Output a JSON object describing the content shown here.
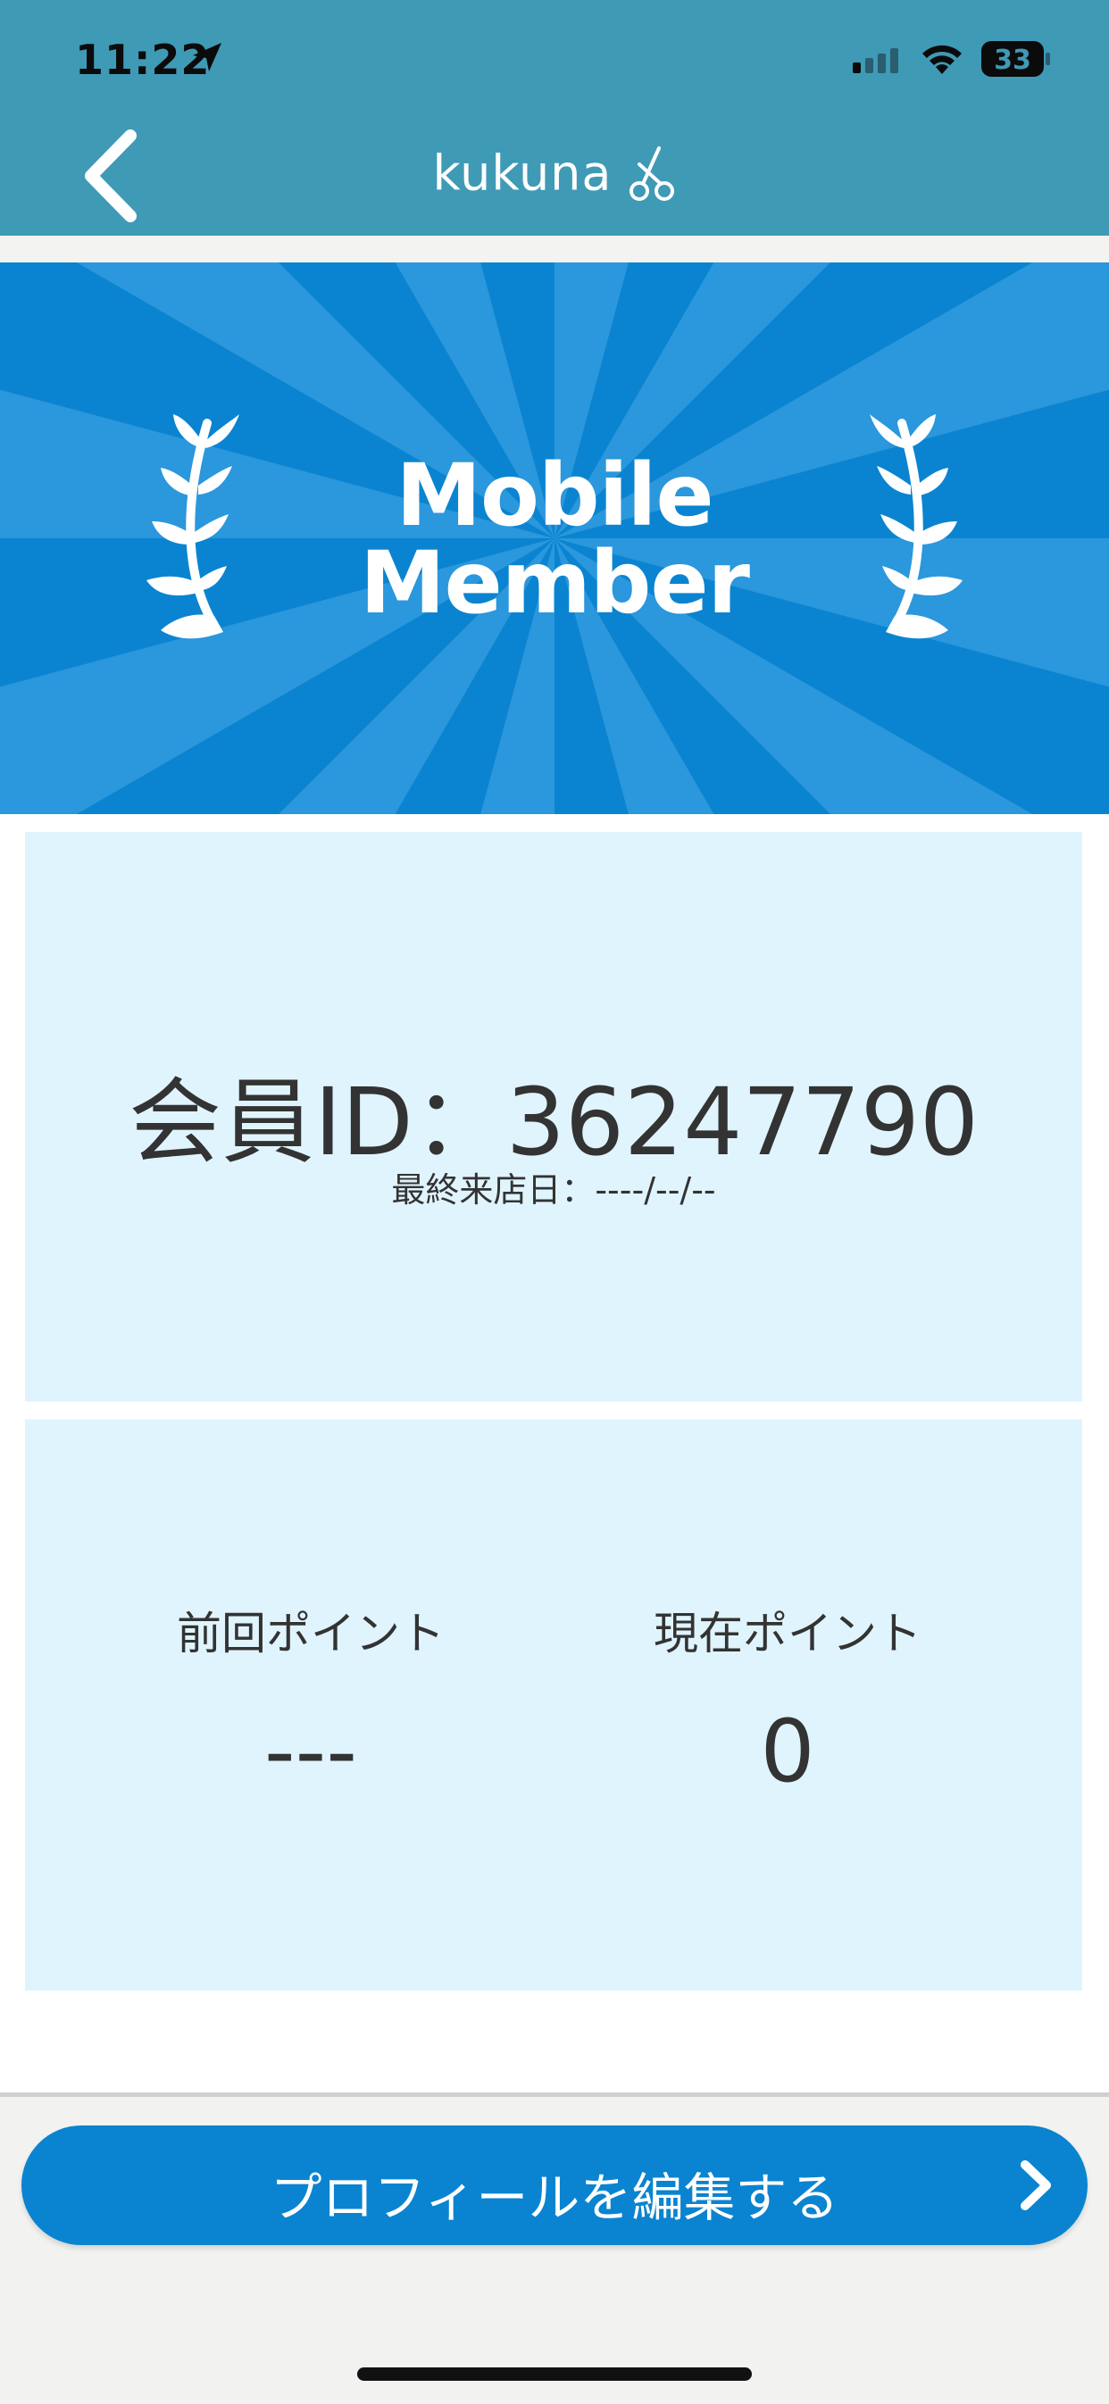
{
  "status": {
    "time": "11:22",
    "battery": "33"
  },
  "nav": {
    "brand": "kukuna",
    "back_icon": "chevron-left-icon",
    "brand_icon": "scissors-icon"
  },
  "banner": {
    "line1": "Mobile",
    "line2": "Member",
    "laurel_icon": "laurel-icon"
  },
  "member": {
    "id_text": "会員ID：36247790",
    "last_visit": "最終来店日：----/--/--"
  },
  "points": {
    "previous_label": "前回ポイント",
    "previous_value": "---",
    "current_label": "現在ポイント",
    "current_value": "0"
  },
  "actions": {
    "edit_profile": "プロフィールを編集する",
    "edit_icon": "chevron-right-icon"
  },
  "colors": {
    "header": "#3f9ab6",
    "banner": "#0a84d0",
    "card": "#e0f4fd",
    "button": "#0a84d0"
  }
}
